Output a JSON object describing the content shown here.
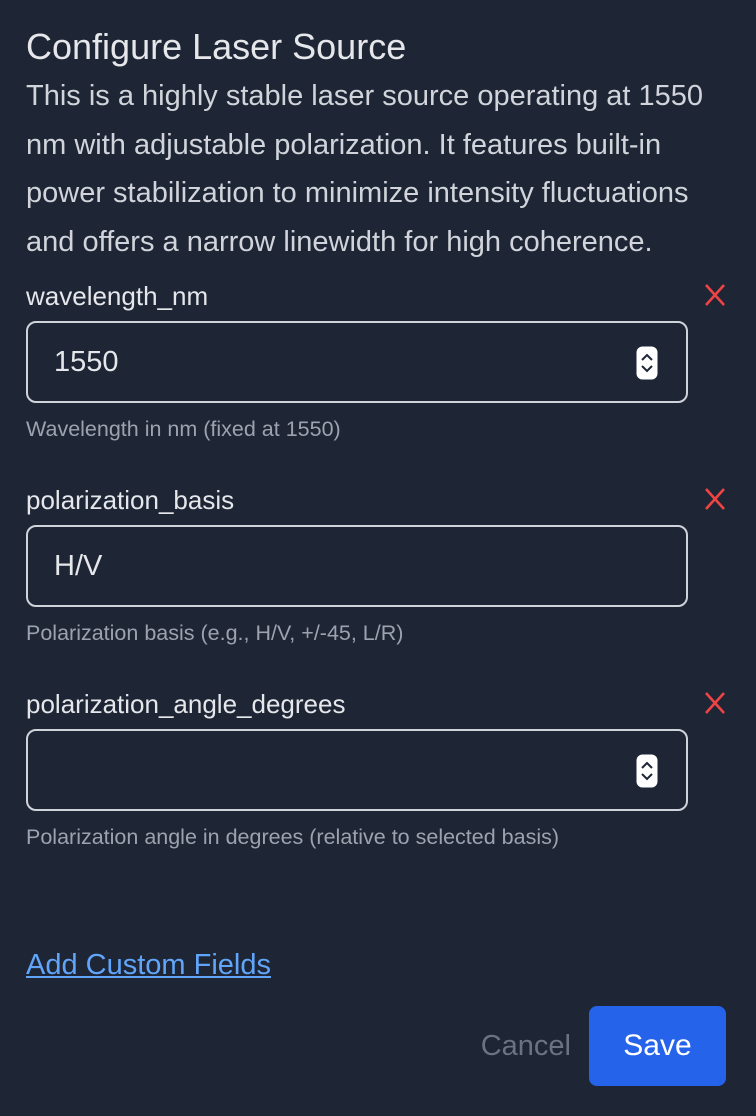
{
  "dialog": {
    "title": "Configure Laser Source",
    "description": "This is a highly stable laser source operating at 1550 nm with adjustable polarization. It features built-in power stabilization to minimize intensity fluctuations and offers a narrow linewidth for high coherence."
  },
  "fields": [
    {
      "label": "wavelength_nm",
      "value": "1550",
      "input_type": "number",
      "help": "Wavelength in nm (fixed at 1550)",
      "remove_glyph": "X"
    },
    {
      "label": "polarization_basis",
      "value": "H/V",
      "input_type": "text",
      "help": "Polarization basis (e.g., H/V, +/-45, L/R)",
      "remove_glyph": "X"
    },
    {
      "label": "polarization_angle_degrees",
      "value": "",
      "input_type": "number",
      "help": "Polarization angle in degrees (relative to selected basis)",
      "remove_glyph": "X"
    }
  ],
  "add_custom_fields_label": "Add Custom Fields",
  "actions": {
    "cancel_label": "Cancel",
    "save_label": "Save"
  },
  "icons": {
    "remove": "close-icon",
    "spinner": "number-spinner-icon"
  },
  "colors": {
    "background": "#1e2535",
    "text": "#e5e7eb",
    "help_text": "#9ca3af",
    "remove": "#ef4444",
    "link": "#60a5fa",
    "primary": "#2563eb",
    "cancel": "#6b7280",
    "input_border": "#cfd3da"
  }
}
